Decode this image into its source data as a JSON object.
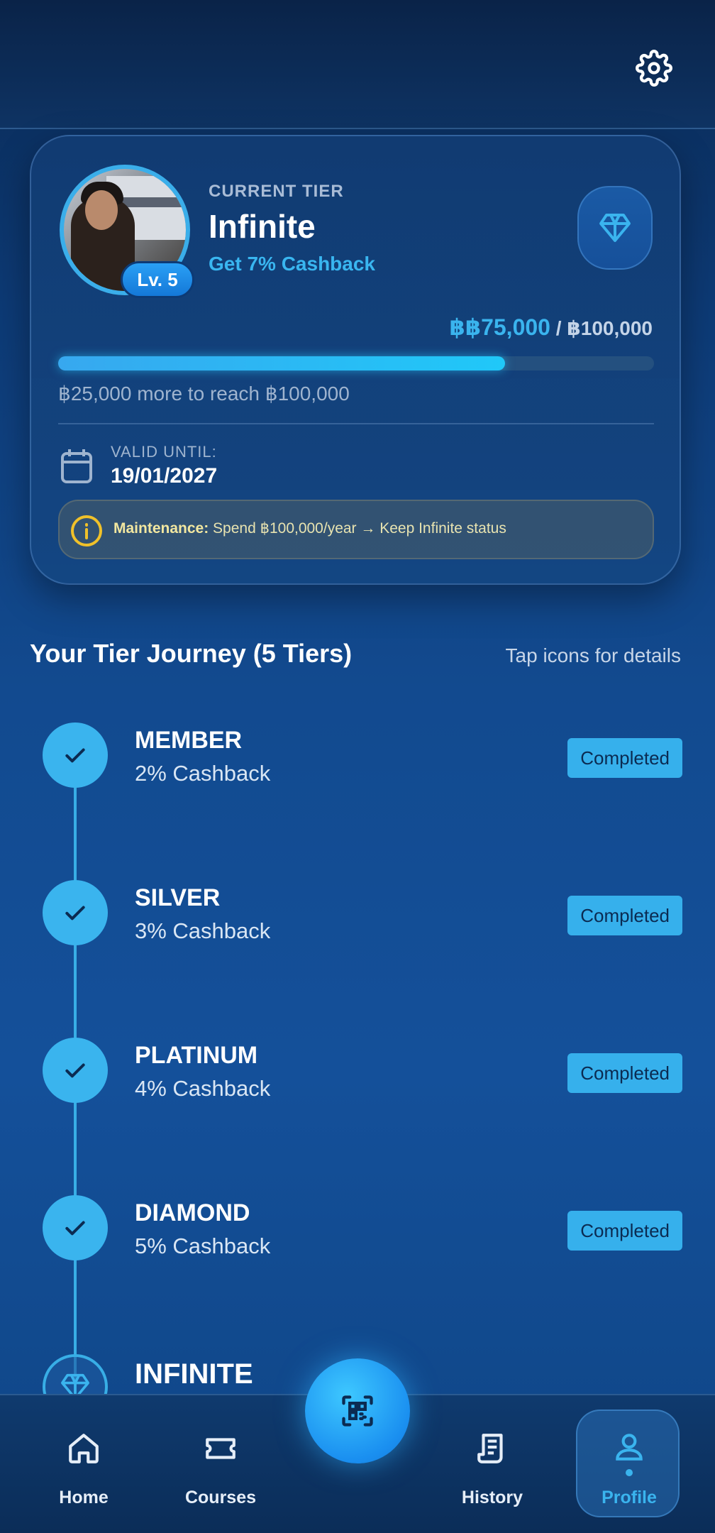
{
  "header": {
    "settings_icon": "gear-icon"
  },
  "tier_card": {
    "level_badge": "Lv. 5",
    "current_tier_label": "CURRENT TIER",
    "tier_name": "Infinite",
    "cashback_text": "Get 7% Cashback",
    "tier_icon": "diamond-icon",
    "spend_current": "฿฿75,000",
    "spend_separator": " / ",
    "spend_target": "฿100,000",
    "progress_fraction": 0.75,
    "progress_note": "฿25,000 more to reach ฿100,000",
    "valid_label": "VALID UNTIL:",
    "valid_date": "19/01/2027",
    "maintenance_label": "Maintenance:",
    "maintenance_text": " Spend ฿100,000/year → Keep Infinite status"
  },
  "journey": {
    "title": "Your Tier Journey (5 Tiers)",
    "hint": "Tap icons for details",
    "tiers": [
      {
        "name": "MEMBER",
        "cashback": "2% Cashback",
        "status": "Completed"
      },
      {
        "name": "SILVER",
        "cashback": "3% Cashback",
        "status": "Completed"
      },
      {
        "name": "PLATINUM",
        "cashback": "4% Cashback",
        "status": "Completed"
      },
      {
        "name": "DIAMOND",
        "cashback": "5% Cashback",
        "status": "Completed"
      },
      {
        "name": "INFINITE"
      }
    ]
  },
  "nav": {
    "items": [
      {
        "label": "Home",
        "icon": "home-icon"
      },
      {
        "label": "Courses",
        "icon": "ticket-icon"
      },
      {
        "label": "History",
        "icon": "receipt-icon"
      },
      {
        "label": "Profile",
        "icon": "user-icon"
      }
    ],
    "scan_icon": "qr-scan-icon"
  },
  "colors": {
    "accent": "#3ab4ee",
    "background": "#14509a"
  }
}
